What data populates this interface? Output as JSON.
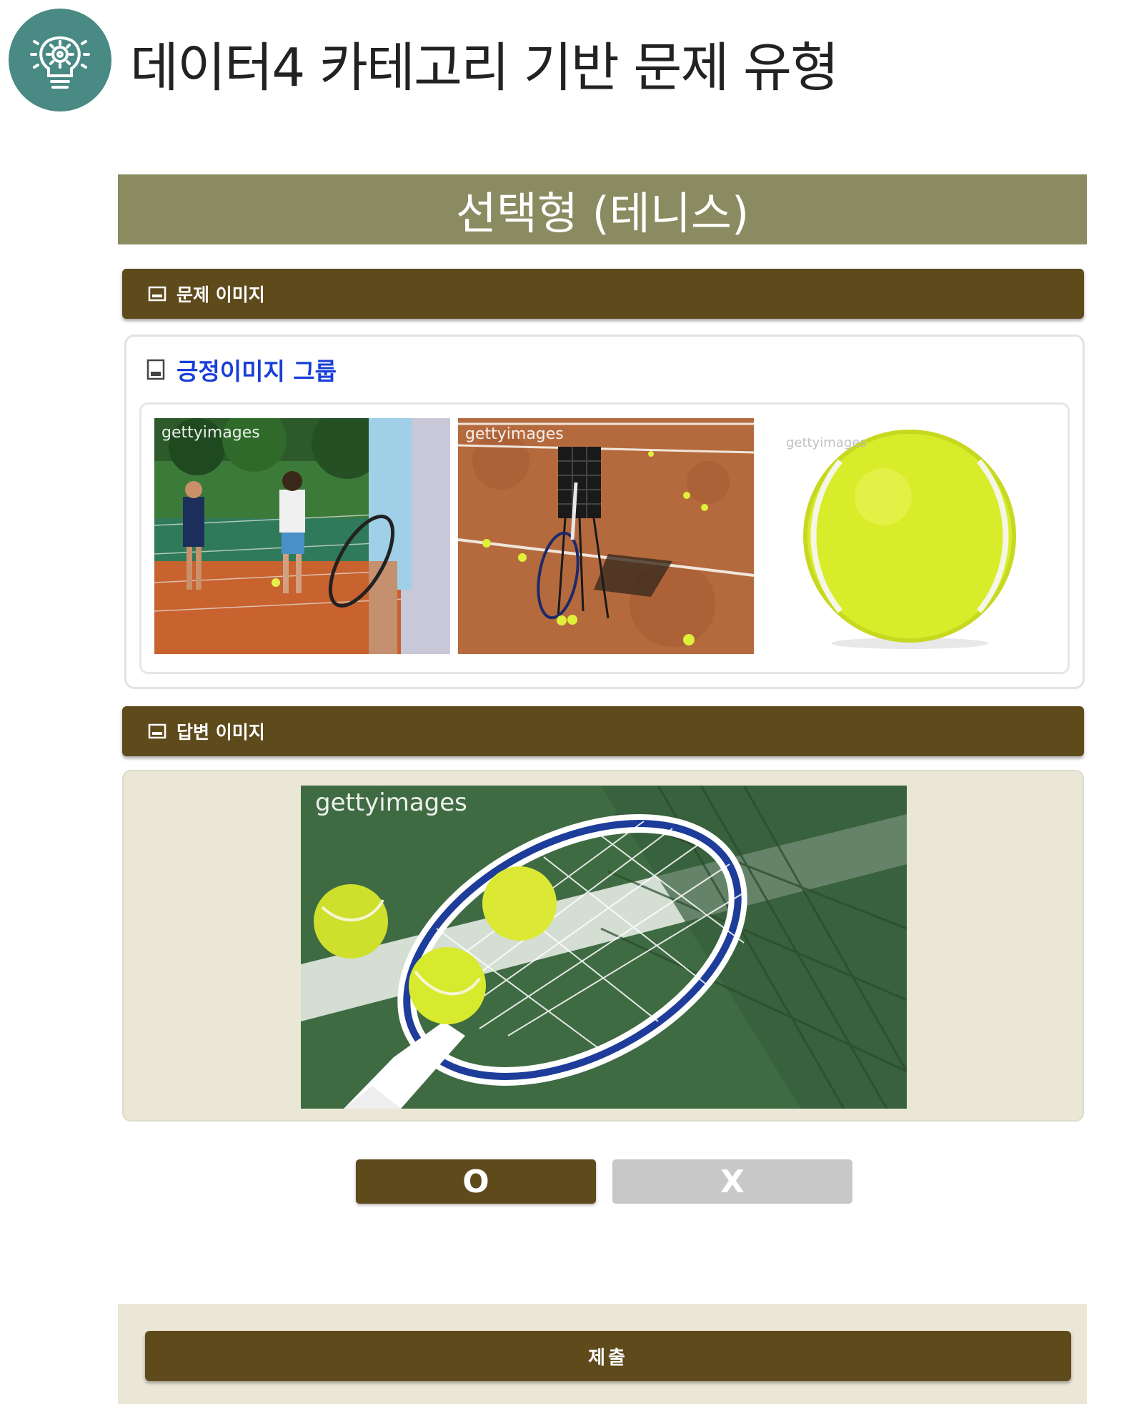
{
  "header": {
    "title": "데이터4 카테고리 기반 문제 유형",
    "icon": "lightbulb-gear-icon",
    "icon_bg": "#4a8a85"
  },
  "banner": {
    "title": "선택형 (테니스)"
  },
  "question_section": {
    "label": "문제 이미지",
    "icon": "image-icon",
    "group": {
      "label": "긍정이미지 그룹",
      "icon": "image-icon",
      "images": [
        {
          "watermark": "gettyimages",
          "subject": "tennis-players-at-net"
        },
        {
          "watermark": "gettyimages",
          "subject": "ball-basket-and-racket-on-clay"
        },
        {
          "watermark": "gettyimages",
          "subject": "tennis-ball"
        }
      ]
    }
  },
  "answer_section": {
    "label": "답변 이미지",
    "icon": "image-icon",
    "image": {
      "watermark": "gettyimages",
      "subject": "racket-and-balls-on-court"
    }
  },
  "choices": {
    "o_label": "O",
    "x_label": "X",
    "selected": "O"
  },
  "submit": {
    "label": "제출"
  },
  "colors": {
    "brand_brown": "#5f4a1c",
    "banner_olive": "#8b8b62",
    "panel_beige": "#ebe7d6",
    "link_blue": "#1a3fd8",
    "disabled_gray": "#c8c8c8"
  }
}
